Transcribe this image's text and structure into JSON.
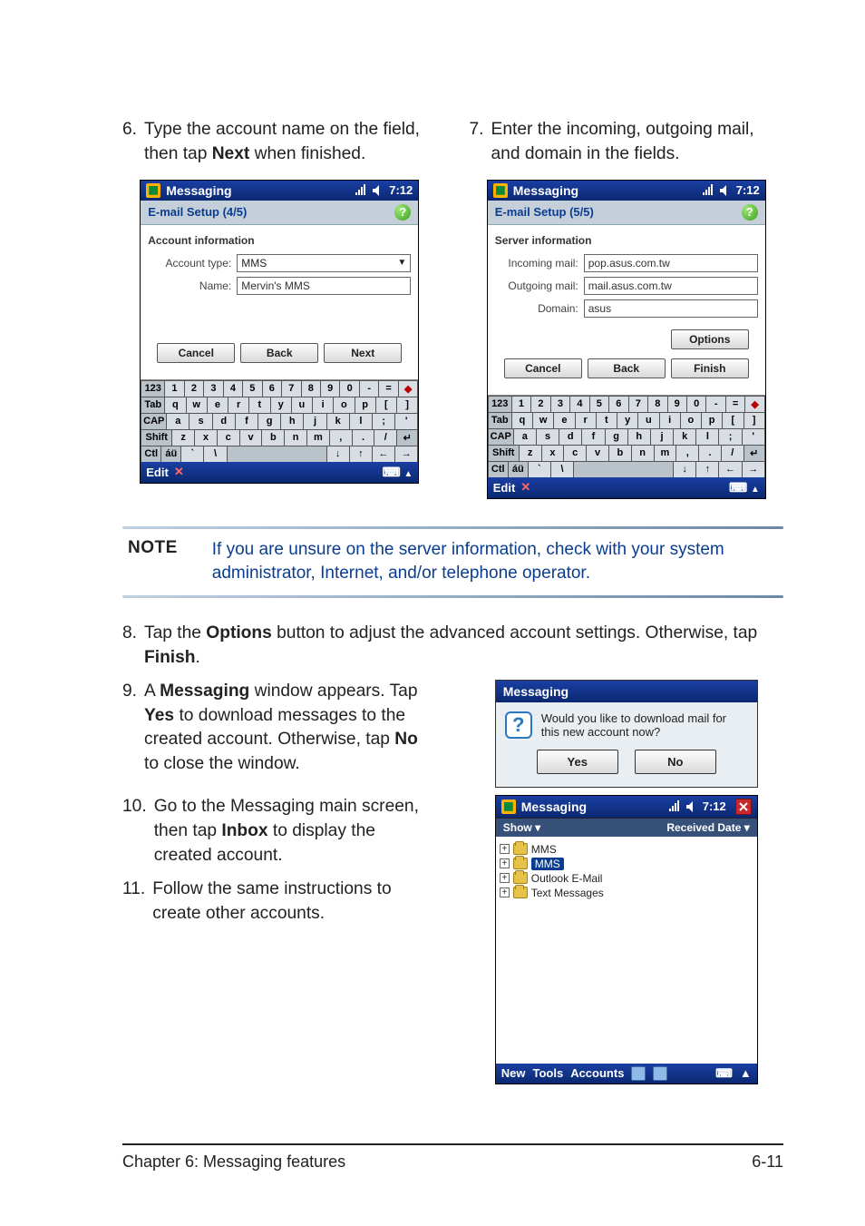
{
  "steps": {
    "s6": {
      "num": "6.",
      "text_before": "Type the account name on the field, then tap ",
      "bold": "Next",
      "text_after": " when finished."
    },
    "s7": {
      "num": "7.",
      "text": "Enter the incoming, outgoing mail, and domain in the fields."
    },
    "s8": {
      "num": "8.",
      "text_before": "Tap the ",
      "bold1": "Options",
      "text_mid": " button to adjust the advanced account settings. Otherwise, tap ",
      "bold2": "Finish",
      "text_after": "."
    },
    "s9": {
      "num": "9.",
      "t1": "A ",
      "b1": "Messaging",
      "t2": " window appears. Tap ",
      "b2": "Yes",
      "t3": " to download messages to the created account. Otherwise, tap ",
      "b3": "No",
      "t4": " to close the window."
    },
    "s10": {
      "num": "10.",
      "t1": "Go to the Messaging main screen, then tap ",
      "b1": "Inbox",
      "t2": " to display the created account."
    },
    "s11": {
      "num": "11.",
      "text": "Follow the same instructions to create other accounts."
    }
  },
  "note": {
    "label": "NOTE",
    "text": "If you are unsure on the server information, check with your system administrator, Internet, and/or telephone operator."
  },
  "device_a": {
    "title": "Messaging",
    "time": "7:12",
    "sub": "E-mail Setup (4/5)",
    "heading": "Account information",
    "acct_type_label": "Account type:",
    "acct_type_value": "MMS",
    "name_label": "Name:",
    "name_value": "Mervin's MMS",
    "btn_cancel": "Cancel",
    "btn_back": "Back",
    "btn_next": "Next",
    "edit": "Edit"
  },
  "device_b": {
    "title": "Messaging",
    "time": "7:12",
    "sub": "E-mail Setup (5/5)",
    "heading": "Server information",
    "in_label": "Incoming mail:",
    "in_value": "pop.asus.com.tw",
    "out_label": "Outgoing mail:",
    "out_value": "mail.asus.com.tw",
    "dom_label": "Domain:",
    "dom_value": "asus",
    "btn_options": "Options",
    "btn_cancel": "Cancel",
    "btn_back": "Back",
    "btn_finish": "Finish",
    "edit": "Edit"
  },
  "keyboard": {
    "row1": [
      "123",
      "1",
      "2",
      "3",
      "4",
      "5",
      "6",
      "7",
      "8",
      "9",
      "0",
      "-",
      "=",
      "◆"
    ],
    "row2": [
      "Tab",
      "q",
      "w",
      "e",
      "r",
      "t",
      "y",
      "u",
      "i",
      "o",
      "p",
      "[",
      "]"
    ],
    "row3": [
      "CAP",
      "a",
      "s",
      "d",
      "f",
      "g",
      "h",
      "j",
      "k",
      "l",
      ";",
      "'"
    ],
    "row4": [
      "Shift",
      "z",
      "x",
      "c",
      "v",
      "b",
      "n",
      "m",
      ",",
      ".",
      "/",
      "↵"
    ],
    "row5": [
      "Ctl",
      "áü",
      "`",
      "\\",
      " ",
      "↓",
      "↑",
      "←",
      "→"
    ]
  },
  "popup": {
    "title": "Messaging",
    "text": "Would you like to download mail for this new account now?",
    "yes": "Yes",
    "no": "No"
  },
  "inbox": {
    "title": "Messaging",
    "time": "7:12",
    "col1": "Show ▾",
    "col2": "Received Date ▾",
    "items": [
      "MMS",
      "MMS",
      "Outlook E-Mail",
      "Text Messages"
    ],
    "bottom": {
      "new": "New",
      "tools": "Tools",
      "accounts": "Accounts"
    }
  },
  "footer": {
    "left": "Chapter 6: Messaging features",
    "right": "6-11"
  }
}
